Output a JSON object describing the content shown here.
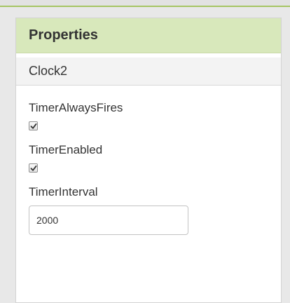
{
  "properties_panel": {
    "title": "Properties",
    "component_name": "Clock2",
    "properties": [
      {
        "label": "TimerAlwaysFires",
        "type": "checkbox",
        "checked": true
      },
      {
        "label": "TimerEnabled",
        "type": "checkbox",
        "checked": true
      },
      {
        "label": "TimerInterval",
        "type": "text",
        "value": "2000"
      }
    ]
  },
  "colors": {
    "header_background": "#d8e8bb",
    "accent_line": "#a6c563",
    "component_bar_background": "#f3f3f3"
  }
}
